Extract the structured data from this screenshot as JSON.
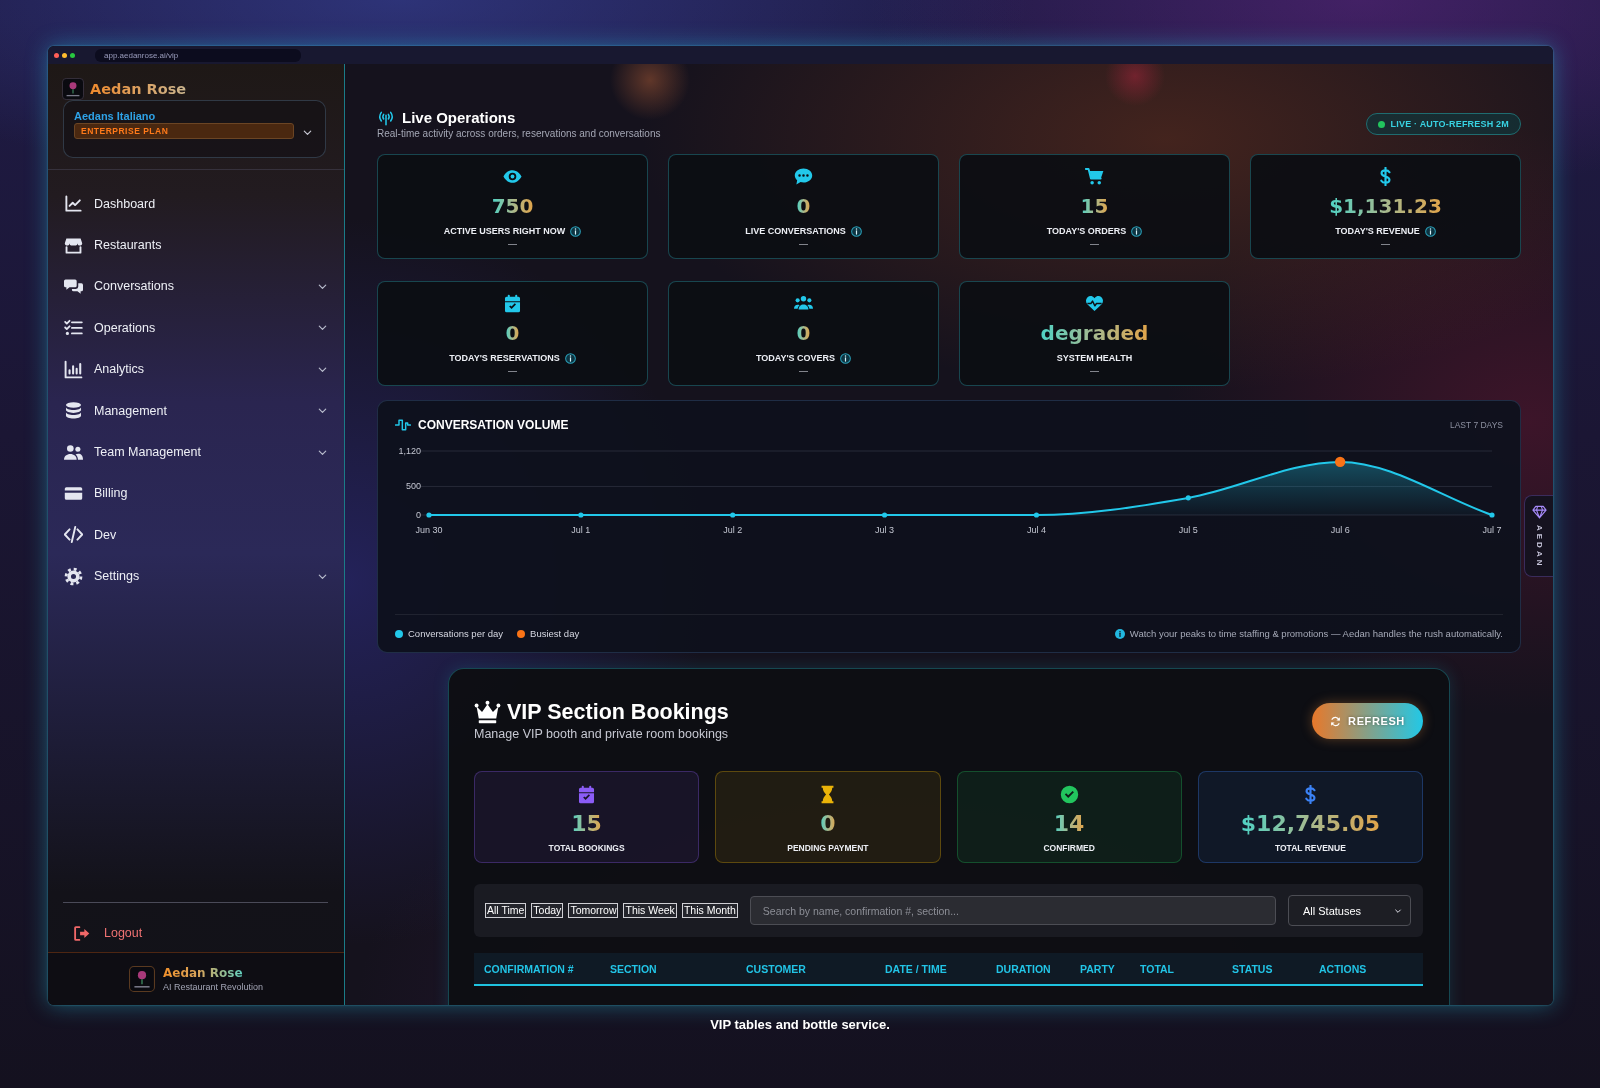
{
  "window": {
    "address": "app.aedanrose.ai/vip"
  },
  "sidebar": {
    "brand": "Aedan Rose",
    "restaurant": {
      "name": "Aedans Italiano",
      "plan": "ENTERPRISE PLAN"
    },
    "items": [
      {
        "label": "Dashboard",
        "submenu": false,
        "selected": false
      },
      {
        "label": "Restaurants",
        "submenu": false,
        "selected": false
      },
      {
        "label": "Conversations",
        "submenu": true,
        "selected": false
      },
      {
        "label": "Operations",
        "submenu": true,
        "selected": false
      },
      {
        "label": "Analytics",
        "submenu": true,
        "selected": false
      },
      {
        "label": "Management",
        "submenu": true,
        "selected": false
      },
      {
        "label": "Team Management",
        "submenu": true,
        "selected": false
      },
      {
        "label": "Billing",
        "submenu": false,
        "selected": false
      },
      {
        "label": "Dev",
        "submenu": false,
        "selected": false
      },
      {
        "label": "Settings",
        "submenu": true,
        "selected": false
      }
    ],
    "logout": "Logout",
    "footer": {
      "brand": "Aedan Rose",
      "tagline": "AI Restaurant Revolution"
    }
  },
  "live_operations": {
    "title": "Live Operations",
    "subtitle": "Real-time activity across orders, reservations and conversations",
    "status_badge": {
      "label": "LIVE · AUTO-REFRESH 2M",
      "live": true
    },
    "stats": [
      {
        "value": "750",
        "label": "ACTIVE USERS RIGHT NOW",
        "info": true,
        "change": "—"
      },
      {
        "value": "0",
        "label": "LIVE CONVERSATIONS",
        "info": true,
        "change": "—"
      },
      {
        "value": "15",
        "label": "TODAY'S ORDERS",
        "info": true,
        "change": "—"
      },
      {
        "value": "$1,131.23",
        "label": "TODAY'S REVENUE",
        "info": true,
        "change": "—"
      },
      {
        "value": "0",
        "label": "TODAY'S RESERVATIONS",
        "info": true,
        "change": "—"
      },
      {
        "value": "0",
        "label": "TODAY'S COVERS",
        "info": true,
        "change": "—"
      },
      {
        "value": "degraded",
        "label": "SYSTEM HEALTH",
        "info": false,
        "change": "—"
      }
    ]
  },
  "conversation_volume": {
    "period": "LAST 7 DAYS",
    "chart_data": {
      "type": "area",
      "title": "CONVERSATION VOLUME",
      "categories": [
        "Jun 30",
        "Jul 1",
        "Jul 2",
        "Jul 3",
        "Jul 4",
        "Jul 5",
        "Jul 6",
        "Jul 7"
      ],
      "series": [
        {
          "name": "Conversations per day",
          "color": "#22c8ea",
          "values": [
            0,
            0,
            0,
            0,
            0,
            300,
            930,
            0
          ]
        }
      ],
      "ylim": [
        0,
        1120
      ],
      "yticks": [
        0,
        500,
        {
          "value": 1120,
          "label": "1,120"
        }
      ]
    },
    "highlight": {
      "label": "Busiest day",
      "color": "#f97316"
    },
    "note": "Watch your peaks to time staffing & promotions — Aedan handles the rush automatically."
  },
  "assistant_tab": {
    "label": "AEDAN"
  },
  "vip": {
    "title": "VIP Section Bookings",
    "subtitle": "Manage VIP booth and private room bookings",
    "refresh": "REFRESH",
    "stats": [
      {
        "value": "15",
        "label": "TOTAL BOOKINGS",
        "color": "#8b5cf6"
      },
      {
        "value": "0",
        "label": "PENDING PAYMENT",
        "color": "#eab308"
      },
      {
        "value": "14",
        "label": "CONFIRMED",
        "color": "#22c55e"
      },
      {
        "value": "$12,745.05",
        "label": "TOTAL REVENUE",
        "color": "#3b82f6"
      }
    ],
    "filters": [
      {
        "label": "All Time",
        "selected": false
      },
      {
        "label": "Today",
        "selected": false
      },
      {
        "label": "Tomorrow",
        "selected": false
      },
      {
        "label": "This Week",
        "selected": false
      },
      {
        "label": "This Month",
        "selected": false
      }
    ],
    "search": {
      "placeholder": "Search by name, confirmation #, section..."
    },
    "status_filter": {
      "value": "All Statuses"
    },
    "table": {
      "columns": [
        "CONFIRMATION #",
        "SECTION",
        "CUSTOMER",
        "DATE / TIME",
        "DURATION",
        "PARTY",
        "TOTAL",
        "STATUS",
        "ACTIONS"
      ]
    }
  },
  "caption": "VIP tables and bottle service."
}
